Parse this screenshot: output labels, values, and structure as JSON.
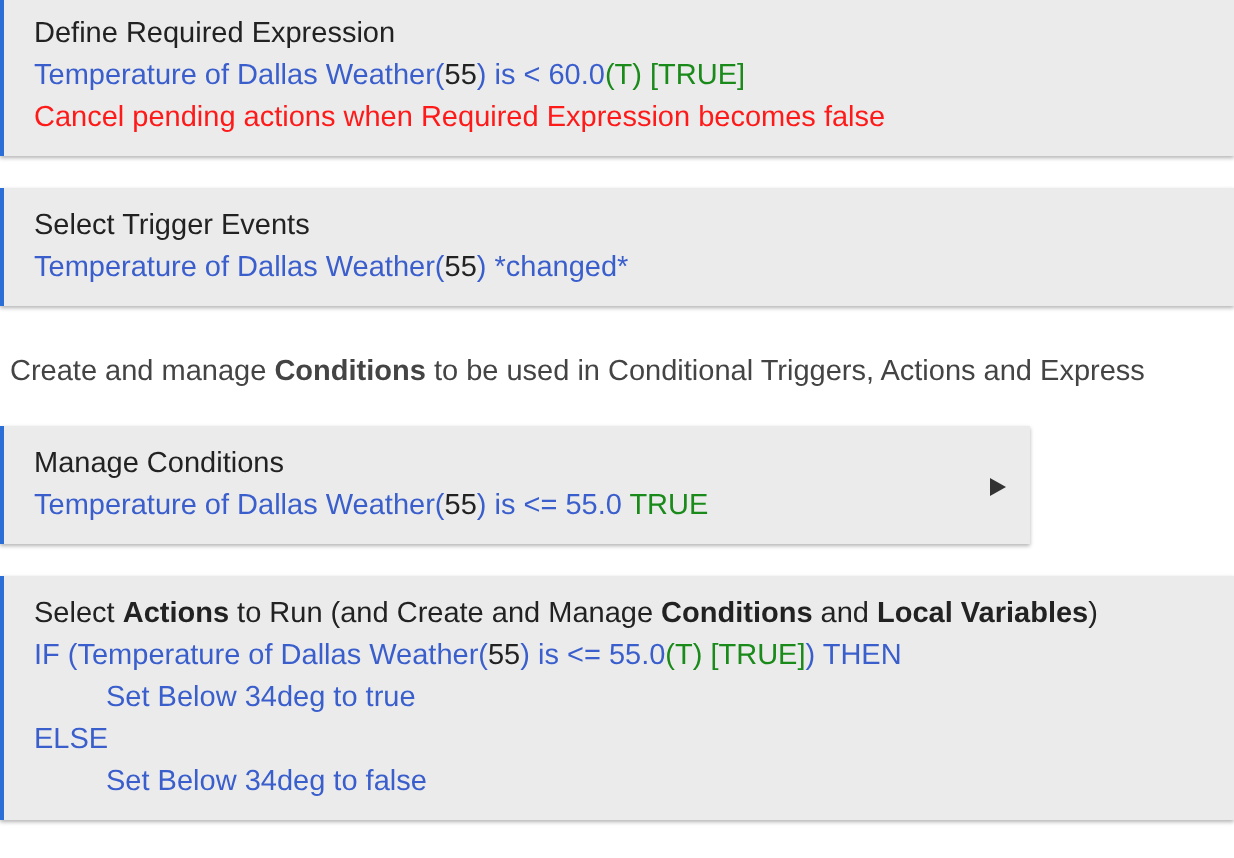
{
  "sections": [
    {
      "kind": "card",
      "title": "Define Required Expression",
      "lines": [
        {
          "segments": [
            {
              "text": "Temperature of Dallas Weather(",
              "color": "#3a5fcd"
            },
            {
              "text": "55",
              "color": "#222222"
            },
            {
              "text": ") is < 60.0",
              "color": "#3a5fcd"
            },
            {
              "text": "(T) [TRUE]",
              "color": "#1a8a1a"
            }
          ]
        },
        {
          "segments": [
            {
              "text": "Cancel pending actions when Required Expression becomes false",
              "color": "#ff1a1a"
            }
          ]
        }
      ]
    },
    {
      "kind": "card",
      "title": "Select Trigger Events",
      "lines": [
        {
          "segments": [
            {
              "text": "Temperature of Dallas Weather(",
              "color": "#3a5fcd"
            },
            {
              "text": "55",
              "color": "#222222"
            },
            {
              "text": ") *changed*",
              "color": "#3a5fcd"
            }
          ]
        }
      ]
    },
    {
      "kind": "note",
      "text": "Create and manage **Conditions** to be used in Conditional Triggers, Actions and Express"
    },
    {
      "kind": "link",
      "title": "Manage Conditions",
      "lines": [
        {
          "segments": [
            {
              "text": "Temperature of Dallas Weather(",
              "color": "#3a5fcd"
            },
            {
              "text": "55",
              "color": "#222222"
            },
            {
              "text": ") is <= 55.0 ",
              "color": "#3a5fcd"
            },
            {
              "text": "TRUE",
              "color": "#1a8a1a"
            }
          ]
        }
      ]
    },
    {
      "kind": "card",
      "title": "Select **Actions** to Run (and Create and Manage **Conditions** and **Local Variables**)",
      "lines": [
        {
          "segments": [
            {
              "text": "IF (Temperature of Dallas Weather(",
              "color": "#3a5fcd"
            },
            {
              "text": "55",
              "color": "#222222"
            },
            {
              "text": ") is <= 55.0",
              "color": "#3a5fcd"
            },
            {
              "text": "(T) [TRUE]",
              "color": "#1a8a1a"
            },
            {
              "text": ") THEN",
              "color": "#3a5fcd"
            }
          ],
          "children": [
            {
              "segments": [
                {
                  "text": "Set Below 34deg to true",
                  "color": "#3a5fcd"
                }
              ]
            }
          ]
        },
        {
          "segments": [
            {
              "text": "ELSE",
              "color": "#3a5fcd"
            }
          ],
          "children": [
            {
              "segments": [
                {
                  "text": "Set Below 34deg to false",
                  "color": "#3a5fcd"
                }
              ]
            }
          ]
        }
      ]
    }
  ]
}
